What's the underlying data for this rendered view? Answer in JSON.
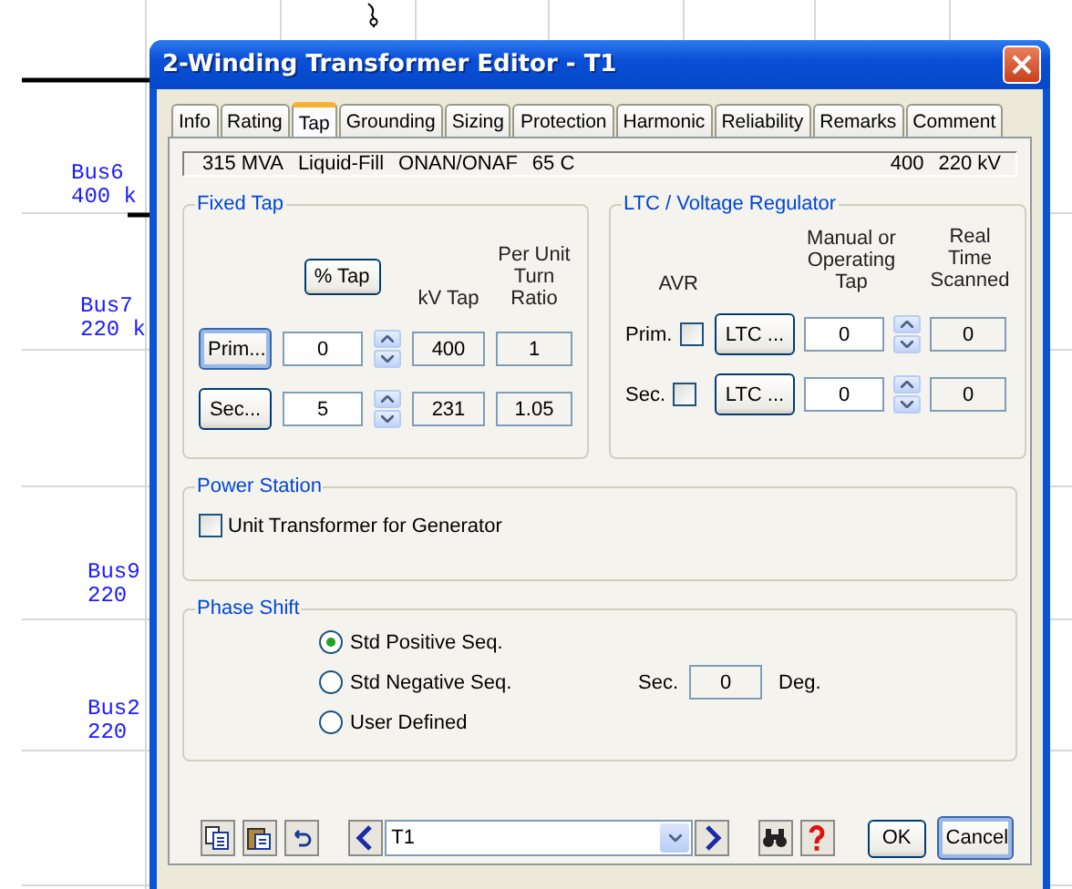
{
  "canvas": {
    "buses": [
      {
        "name": "Bus6",
        "voltage": "400 k"
      },
      {
        "name": "Bus7",
        "voltage": "220 k"
      },
      {
        "name": "Bus9",
        "voltage": "220"
      },
      {
        "name": "Bus2",
        "voltage": "220"
      }
    ]
  },
  "window": {
    "title": "2-Winding Transformer Editor - T1"
  },
  "tabs": [
    {
      "label": "Info",
      "selected": false
    },
    {
      "label": "Rating",
      "selected": false
    },
    {
      "label": "Tap",
      "selected": true
    },
    {
      "label": "Grounding",
      "selected": false
    },
    {
      "label": "Sizing",
      "selected": false
    },
    {
      "label": "Protection",
      "selected": false
    },
    {
      "label": "Harmonic",
      "selected": false
    },
    {
      "label": "Reliability",
      "selected": false
    },
    {
      "label": "Remarks",
      "selected": false
    },
    {
      "label": "Comment",
      "selected": false
    }
  ],
  "summary": {
    "rating": "315 MVA",
    "type": "Liquid-Fill",
    "cooling": "ONAN/ONAF",
    "temperature": "65 C",
    "primary_kv": "400",
    "secondary_kv": "220 kV"
  },
  "fixed_tap": {
    "title": "Fixed Tap",
    "percent_button": "% Tap",
    "kv_heading": "kV Tap",
    "ratio_heading": "Per Unit Turn Ratio",
    "rows": [
      {
        "button": "Prim...",
        "tap": "0",
        "kv": "400",
        "ratio": "1",
        "focused": true
      },
      {
        "button": "Sec...",
        "tap": "5",
        "kv": "231",
        "ratio": "1.05",
        "focused": false
      }
    ]
  },
  "ltc": {
    "title": "LTC / Voltage Regulator",
    "avr_heading": "AVR",
    "tap_heading": "Manual or Operating Tap",
    "scanned_heading": "Real Time Scanned",
    "rows": [
      {
        "label": "Prim.",
        "avr_checked": false,
        "button": "LTC ...",
        "tap": "0",
        "scanned": "0"
      },
      {
        "label": "Sec.",
        "avr_checked": false,
        "button": "LTC ...",
        "tap": "0",
        "scanned": "0"
      }
    ]
  },
  "power_station": {
    "title": "Power Station",
    "checkbox": {
      "label": "Unit Transformer for Generator",
      "checked": false
    }
  },
  "phase_shift": {
    "title": "Phase Shift",
    "options": [
      {
        "label": "Std Positive Seq.",
        "selected": true
      },
      {
        "label": "Std Negative Seq.",
        "selected": false
      },
      {
        "label": "User Defined",
        "selected": false
      }
    ],
    "angle_label": "Sec.",
    "angle": "0",
    "angle_unit": "Deg."
  },
  "footer": {
    "element": "T1",
    "ok": "OK",
    "cancel": "Cancel"
  }
}
